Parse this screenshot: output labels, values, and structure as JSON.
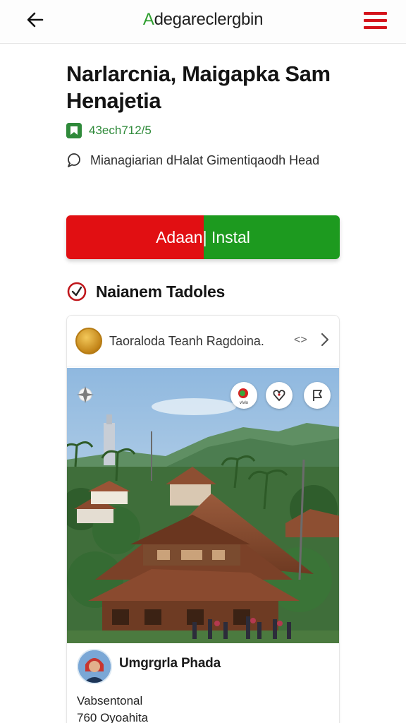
{
  "header": {
    "brand_green": "A",
    "brand_rest": "degareclergbin",
    "back_icon": "arrow-left-icon",
    "menu_icon": "hamburger-menu-icon"
  },
  "listing": {
    "title": "Narlarcnia, Maigapka Sam Henajetia",
    "meta": "43ech712/5",
    "meta_icon": "app-badge-icon",
    "location": "Mianagiarian dHalat Gimentiqaodh Head",
    "location_icon": "chat-bubble-icon"
  },
  "install_button": {
    "label": "Adaan| Instal",
    "left_color": "#e10f12",
    "right_color": "#1d9a1f"
  },
  "section": {
    "title": "Naianem Tadoles",
    "icon": "check-circle-icon"
  },
  "card": {
    "header_text": "Taoraloda Teanh Ragdoina.",
    "header_dots": "<>",
    "photo_icons": [
      "compass-icon",
      "badge-icon",
      "heart-icon",
      "flag-icon"
    ],
    "badge_text": "vlvlo",
    "author_name": "Umgrgrla Phada",
    "author_role": "Vabsentonal",
    "author_count": "760 Oyoahita"
  },
  "colors": {
    "accent_green": "#2e9e2e",
    "accent_red": "#d4131b"
  }
}
